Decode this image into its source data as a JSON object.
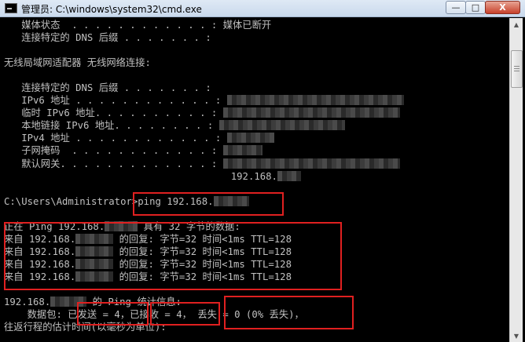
{
  "window": {
    "title": "管理员: C:\\windows\\system32\\cmd.exe",
    "min_label": "—",
    "max_label": "□",
    "close_label": "X"
  },
  "console": {
    "lines": [
      {
        "kind": "text",
        "text": "   媒体状态  . . . . . . . . . . . . : 媒体已断开"
      },
      {
        "kind": "text",
        "text": "   连接特定的 DNS 后缀 . . . . . . . :"
      },
      {
        "kind": "text",
        "text": ""
      },
      {
        "kind": "text",
        "text": "无线局域网适配器 无线网络连接:"
      },
      {
        "kind": "text",
        "text": ""
      },
      {
        "kind": "text",
        "text": "   连接特定的 DNS 后缀 . . . . . . . :"
      },
      {
        "kind": "masked",
        "text": "   IPv6 地址 . . . . . . . . . . . . : ",
        "mask": 225
      },
      {
        "kind": "masked",
        "text": "   临时 IPv6 地址. . . . . . . . . . : ",
        "mask": 225
      },
      {
        "kind": "masked",
        "text": "   本地链接 IPv6 地址. . . . . . . . : ",
        "mask": 160
      },
      {
        "kind": "masked",
        "text": "   IPv4 地址 . . . . . . . . . . . . : ",
        "mask": 60
      },
      {
        "kind": "masked",
        "text": "   子网掩码  . . . . . . . . . . . . : ",
        "mask": 50
      },
      {
        "kind": "masked",
        "text": "   默认网关. . . . . . . . . . . . . : ",
        "mask": 225
      },
      {
        "kind": "masked_after",
        "text": "                                       192.168.",
        "mask": 30
      },
      {
        "kind": "text",
        "text": ""
      },
      {
        "kind": "masked",
        "text": "C:\\Users\\Administrator>ping 192.168.",
        "mask": 45
      },
      {
        "kind": "text",
        "text": ""
      },
      {
        "kind": "masked_mid",
        "text": "正在 Ping 192.168.",
        "mask": 42,
        "after": " 具有 32 字节的数据:"
      },
      {
        "kind": "masked_mid",
        "text": "来自 192.168.",
        "mask": 48,
        "after": " 的回复: 字节=32 时间<1ms TTL=128"
      },
      {
        "kind": "masked_mid",
        "text": "来自 192.168.",
        "mask": 48,
        "after": " 的回复: 字节=32 时间<1ms TTL=128"
      },
      {
        "kind": "masked_mid",
        "text": "来自 192.168.",
        "mask": 48,
        "after": " 的回复: 字节=32 时间<1ms TTL=128"
      },
      {
        "kind": "masked_mid",
        "text": "来自 192.168.",
        "mask": 48,
        "after": " 的回复: 字节=32 时间<1ms TTL=128"
      },
      {
        "kind": "text",
        "text": ""
      },
      {
        "kind": "masked_mid",
        "text": "192.168.",
        "mask": 46,
        "after": " 的 Ping 统计信息:"
      },
      {
        "kind": "text",
        "text": "    数据包: 已发送 = 4，已接收 = 4， 丢失 = 0 (0% 丢失)，"
      },
      {
        "kind": "text",
        "text": "往返行程的估计时间(以毫秒为单位):"
      }
    ]
  },
  "colors": {
    "console_bg": "#000000",
    "console_fg": "#c0c0c0",
    "highlight": "#e02020"
  }
}
